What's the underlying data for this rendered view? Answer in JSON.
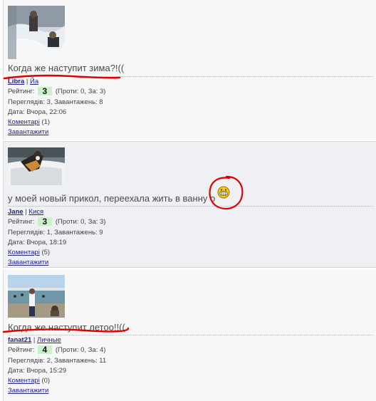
{
  "posts": [
    {
      "title": "Когда же наступит зима?!((",
      "author": "Libra",
      "separator": "|",
      "category": "Йа",
      "rating_label": "Рейтинг:",
      "rating_value": "3",
      "rating_detail": "(Проти: 0, За: 3)",
      "views_text": "Переглядів: 3, Завантажень: 8",
      "date_text": "Дата: Вчора, 22:06",
      "comments_label": "Коментарі",
      "comments_count": "(1)",
      "download_label": "Завантажити"
    },
    {
      "title": "у моей новый прикол, переехала жить в ванну",
      "title_trailing_letter": "о",
      "author": "Jane",
      "separator": "|",
      "category": "Кися",
      "rating_label": "Рейтинг:",
      "rating_value": "3",
      "rating_detail": "(Проти: 0, За: 3)",
      "views_text": "Переглядів: 1, Завантажень: 9",
      "date_text": "Дата: Вчора, 18:19",
      "comments_label": "Коментарі",
      "comments_count": "(5)",
      "download_label": "Завантажити"
    },
    {
      "title": "Когда же наступит летоо!!((",
      "author": "fanat21",
      "separator": "|",
      "category": "Личные",
      "rating_label": "Рейтинг:",
      "rating_value": "4",
      "rating_detail": "(Проти: 0, За: 4)",
      "views_text": "Переглядів: 2, Завантажень: 11",
      "date_text": "Дата: Вчора, 15:29",
      "comments_label": "Коментарі",
      "comments_count": "(0)",
      "download_label": "Завантажити"
    }
  ],
  "colors": {
    "link": "#23238e",
    "annotation_red": "#e00000",
    "rating_badge": "#c9f2c9"
  }
}
